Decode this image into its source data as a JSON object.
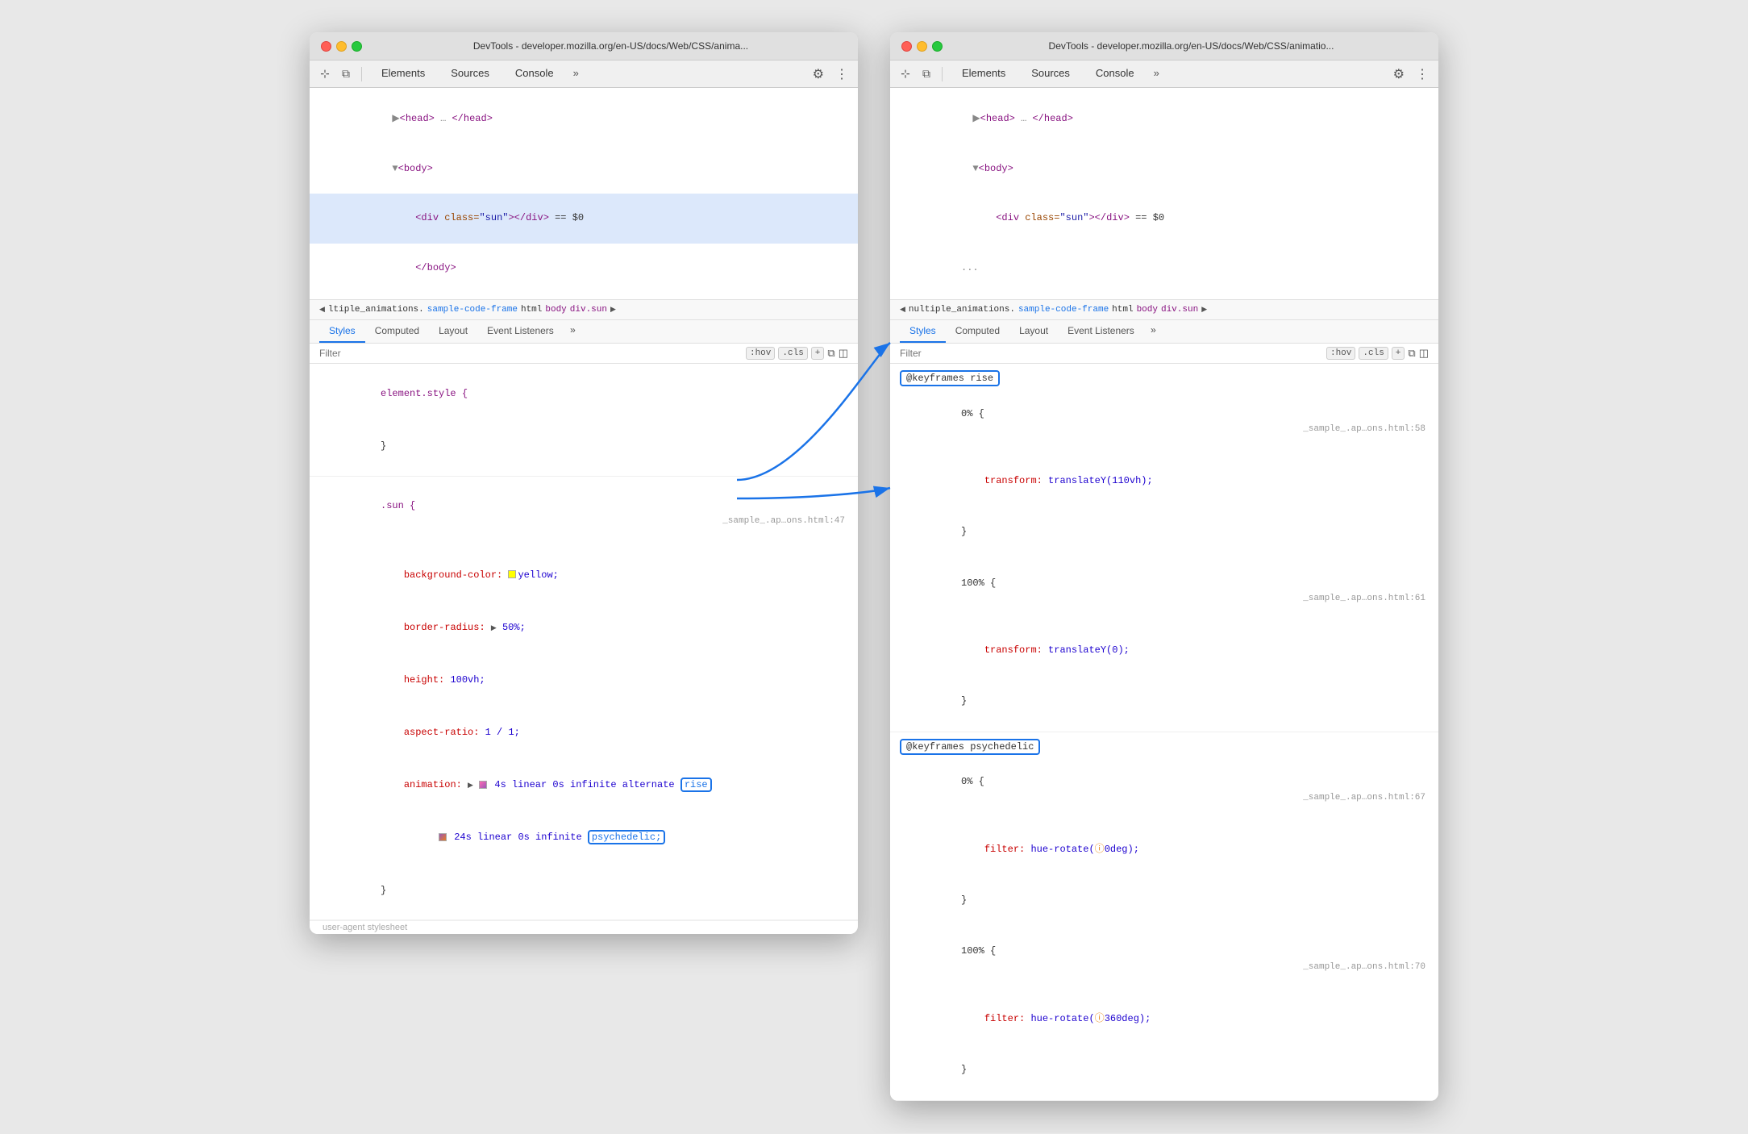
{
  "window1": {
    "title": "DevTools - developer.mozilla.org/en-US/docs/Web/CSS/anima...",
    "tabs": [
      "Elements",
      "Sources",
      "Console"
    ],
    "active_tab": "Elements",
    "html_tree": [
      {
        "indent": 2,
        "content": "<head>",
        "ellipsis": "…",
        "close": "</head>",
        "type": "collapsed"
      },
      {
        "indent": 2,
        "content": "<body>",
        "type": "open-triangle"
      },
      {
        "indent": 4,
        "content": "<div class=\"sun\"></div>",
        "selected": true,
        "dollar": "== $0"
      },
      {
        "indent": 4,
        "content": "</body>",
        "type": "close"
      }
    ],
    "breadcrumb": {
      "prefix": "◀",
      "items": [
        "ltiple_animations.",
        "sample-code-frame",
        "html",
        "body",
        "div.sun"
      ],
      "suffix": "▶"
    },
    "styles_tabs": [
      "Styles",
      "Computed",
      "Layout",
      "Event Listeners",
      "»"
    ],
    "active_styles_tab": "Styles",
    "filter_placeholder": "Filter",
    "filter_buttons": [
      ":hov",
      ".cls",
      "+"
    ],
    "rules": [
      {
        "selector": "element.style {",
        "close": "}",
        "properties": []
      },
      {
        "selector": ".sun {",
        "source": "_sample_.ap…ons.html:47",
        "close": "}",
        "properties": [
          {
            "name": "background-color:",
            "swatch": "#ffff00",
            "value": "yellow;"
          },
          {
            "name": "border-radius:",
            "triangle": "▶",
            "value": "50%;"
          },
          {
            "name": "height:",
            "value": "100vh;"
          },
          {
            "name": "aspect-ratio:",
            "value": "1 / 1;"
          },
          {
            "name": "animation:",
            "triangle": "▶",
            "swatch2": true,
            "value": "4s linear 0s infinite alternate ",
            "highlight": "rise"
          },
          {
            "name": "",
            "indent": true,
            "swatch3": true,
            "value": "24s linear 0s infinite ",
            "highlight2": "psychedelic;"
          }
        ]
      }
    ],
    "user_agent_line": "user-agent stylesheet"
  },
  "window2": {
    "title": "DevTools - developer.mozilla.org/en-US/docs/Web/CSS/animatio...",
    "tabs": [
      "Elements",
      "Sources",
      "Console"
    ],
    "active_tab": "Elements",
    "html_tree": [
      {
        "indent": 2,
        "content": "<head>",
        "ellipsis": "…",
        "close": "</head>",
        "type": "collapsed"
      },
      {
        "indent": 2,
        "content": "<body>",
        "type": "open-triangle"
      },
      {
        "indent": 4,
        "content": "<div class=\"sun\"></div>",
        "selected": false,
        "dollar": "== $0"
      },
      {
        "indent": 4,
        "extra_line": "..."
      }
    ],
    "breadcrumb": {
      "prefix": "◀",
      "items": [
        "nultiple_animations.",
        "sample-code-frame",
        "html",
        "body",
        "div.sun"
      ],
      "suffix": "▶"
    },
    "styles_tabs": [
      "Styles",
      "Computed",
      "Layout",
      "Event Listeners",
      "»"
    ],
    "active_styles_tab": "Styles",
    "filter_placeholder": "Filter",
    "filter_buttons": [
      ":hov",
      ".cls",
      "+"
    ],
    "keyframes": [
      {
        "name": "@keyframes rise",
        "sections": [
          {
            "percent": "0% {",
            "source": "_sample_.ap…ons.html:58",
            "close": "}",
            "properties": [
              {
                "name": "transform:",
                "value": "translateY(110vh);"
              }
            ]
          },
          {
            "percent": "100% {",
            "source": "_sample_.ap…ons.html:61",
            "close": "}",
            "properties": [
              {
                "name": "transform:",
                "value": "translateY(0);"
              }
            ]
          }
        ]
      },
      {
        "name": "@keyframes psychedelic",
        "sections": [
          {
            "percent": "0% {",
            "source": "_sample_.ap…ons.html:67",
            "close": "}",
            "properties": [
              {
                "name": "filter:",
                "value": "hue-rotate(",
                "warning": true,
                "value2": "0deg);"
              }
            ]
          },
          {
            "percent": "100% {",
            "source": "_sample_.ap…ons.html:70",
            "close": "}",
            "properties": [
              {
                "name": "filter:",
                "value": "hue-rotate(",
                "warning": true,
                "value2": "360deg);"
              }
            ]
          }
        ]
      }
    ]
  },
  "icons": {
    "cursor": "⊹",
    "layers": "⧉",
    "gear": "⚙",
    "more": "⋮",
    "more_tabs": "»",
    "copy": "⧉",
    "sidebar": "◫"
  }
}
